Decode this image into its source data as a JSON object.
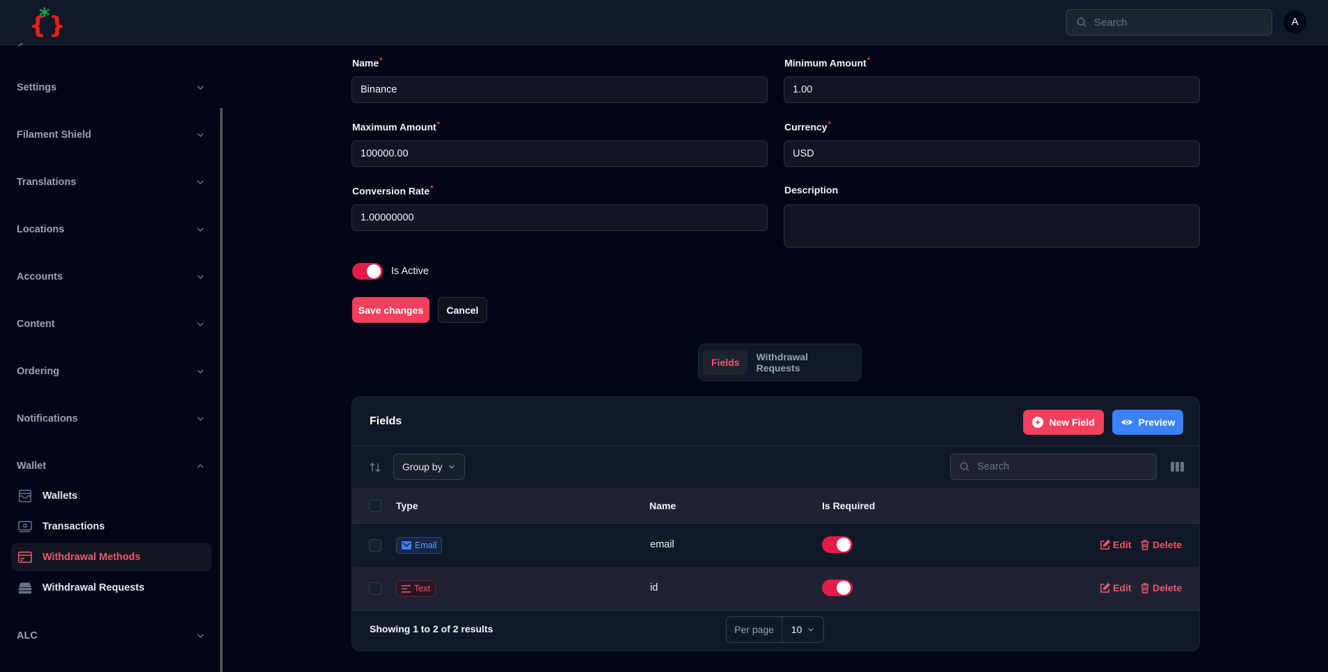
{
  "topbar": {
    "search_placeholder": "Search",
    "avatar_initial": "A"
  },
  "sidebar": {
    "groups": [
      {
        "label": "Settings",
        "expanded": false
      },
      {
        "label": "Filament Shield",
        "expanded": false
      },
      {
        "label": "Translations",
        "expanded": false
      },
      {
        "label": "Locations",
        "expanded": false
      },
      {
        "label": "Accounts",
        "expanded": false
      },
      {
        "label": "Content",
        "expanded": false
      },
      {
        "label": "Ordering",
        "expanded": false
      },
      {
        "label": "Notifications",
        "expanded": false
      },
      {
        "label": "Wallet",
        "expanded": true
      },
      {
        "label": "ALC",
        "expanded": false
      }
    ],
    "wallet_items": [
      {
        "label": "Wallets",
        "icon": "wallet-icon",
        "active": false
      },
      {
        "label": "Transactions",
        "icon": "banknote-icon",
        "active": false
      },
      {
        "label": "Withdrawal Methods",
        "icon": "credit-card-icon",
        "active": true
      },
      {
        "label": "Withdrawal Requests",
        "icon": "inbox-stack-icon",
        "active": false
      }
    ]
  },
  "form": {
    "name": {
      "label": "Name",
      "required": "*",
      "value": "Binance"
    },
    "minimum_amount": {
      "label": "Minimum Amount",
      "required": "*",
      "value": "1.00"
    },
    "maximum_amount": {
      "label": "Maximum Amount",
      "required": "*",
      "value": "100000.00"
    },
    "currency": {
      "label": "Currency",
      "required": "*",
      "value": "USD"
    },
    "conversion_rate": {
      "label": "Conversion Rate",
      "required": "*",
      "value": "1.00000000"
    },
    "description": {
      "label": "Description",
      "value": ""
    },
    "is_active": {
      "label": "Is Active",
      "checked": true
    },
    "save_label": "Save changes",
    "cancel_label": "Cancel"
  },
  "tabs": [
    {
      "label": "Fields",
      "active": true
    },
    {
      "label": "Withdrawal Requests",
      "active": false
    }
  ],
  "fields_table": {
    "title": "Fields",
    "new_field_label": "New Field",
    "preview_label": "Preview",
    "group_by_label": "Group by",
    "search_placeholder": "Search",
    "columns": [
      "Type",
      "Name",
      "Is Required"
    ],
    "rows": [
      {
        "type": "Email",
        "name": "email",
        "is_required": true,
        "edit_label": "Edit",
        "delete_label": "Delete"
      },
      {
        "type": "Text",
        "name": "id",
        "is_required": true,
        "edit_label": "Edit",
        "delete_label": "Delete"
      }
    ],
    "summary": "Showing 1 to 2 of 2 results",
    "per_page_label": "Per page",
    "per_page_value": "10"
  },
  "colors": {
    "primary": "#f43f5e",
    "toggle_on": "#e11d48",
    "blue": "#3b82f6",
    "background": "#030617"
  }
}
